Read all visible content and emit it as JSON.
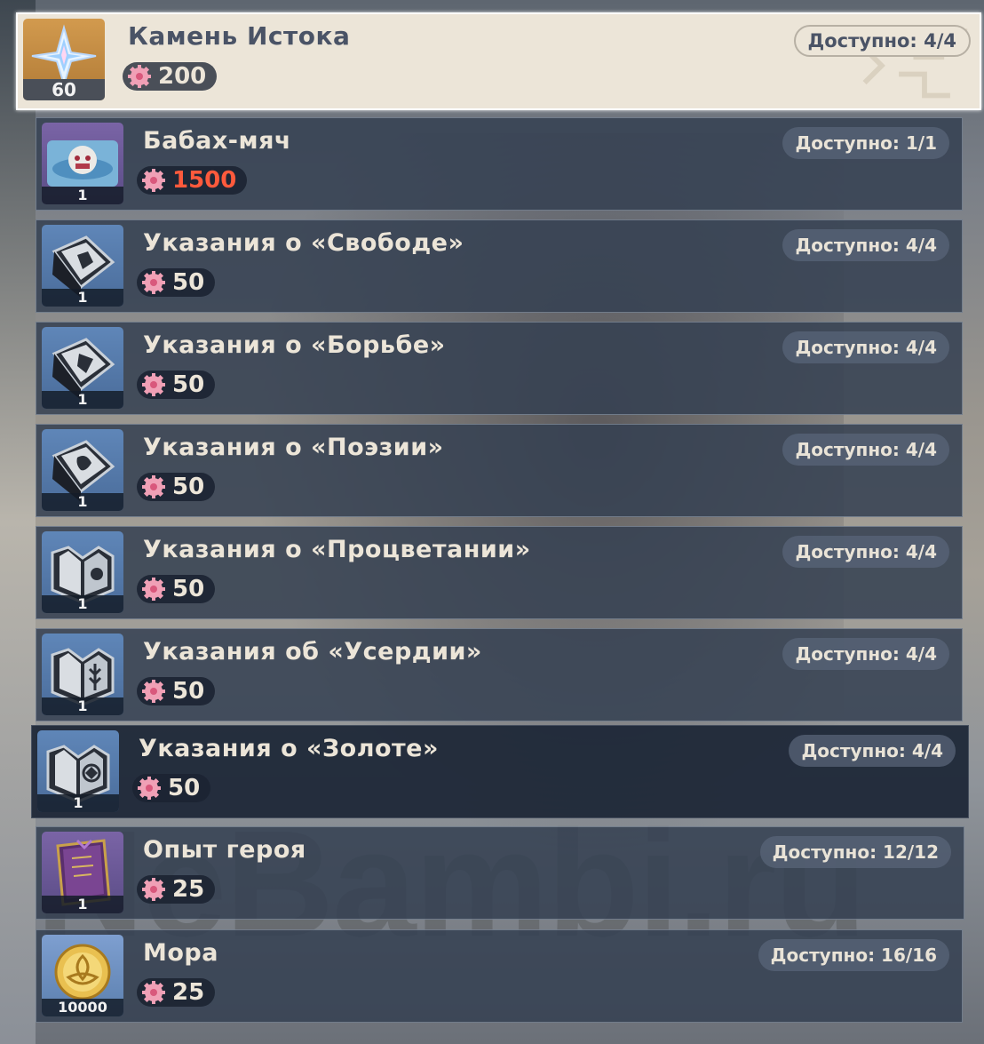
{
  "shop": {
    "items": [
      {
        "title": "Камень Истока",
        "price": "200",
        "price_style": "normal",
        "availability": "Доступно: 4/4",
        "count": "60",
        "icon": "primogem-icon"
      },
      {
        "title": "Бабах-мяч",
        "price": "1500",
        "price_style": "red",
        "availability": "Доступно: 1/1",
        "count": "1",
        "icon": "blast-ball-icon"
      },
      {
        "title": "Указания о «Свободе»",
        "price": "50",
        "price_style": "normal",
        "availability": "Доступно: 4/4",
        "count": "1",
        "icon": "book-freedom-icon"
      },
      {
        "title": "Указания о «Борьбе»",
        "price": "50",
        "price_style": "normal",
        "availability": "Доступно: 4/4",
        "count": "1",
        "icon": "book-resistance-icon"
      },
      {
        "title": "Указания о «Поэзии»",
        "price": "50",
        "price_style": "normal",
        "availability": "Доступно: 4/4",
        "count": "1",
        "icon": "book-ballad-icon"
      },
      {
        "title": "Указания о «Процветании»",
        "price": "50",
        "price_style": "normal",
        "availability": "Доступно: 4/4",
        "count": "1",
        "icon": "book-prosperity-icon"
      },
      {
        "title": "Указания об «Усердии»",
        "price": "50",
        "price_style": "normal",
        "availability": "Доступно: 4/4",
        "count": "1",
        "icon": "book-diligence-icon"
      },
      {
        "title": "Указания о «Золоте»",
        "price": "50",
        "price_style": "normal",
        "availability": "Доступно: 4/4",
        "count": "1",
        "icon": "book-gold-icon"
      },
      {
        "title": "Опыт героя",
        "price": "25",
        "price_style": "normal",
        "availability": "Доступно: 12/12",
        "count": "1",
        "icon": "heros-wit-icon"
      },
      {
        "title": "Мора",
        "price": "25",
        "price_style": "normal",
        "availability": "Доступно: 16/16",
        "count": "10000",
        "icon": "mora-coin-icon"
      }
    ],
    "currency_icon": "stardust-gear-icon"
  },
  "watermark": "NeBambi.ru",
  "colors": {
    "title_light": "#ece5d8",
    "title_dark": "#4a5366",
    "price_red": "#ff5a3c",
    "row_bg": "#344052",
    "row_selected_bg": "#1c2636",
    "top_row_bg": "#ece5d8"
  }
}
